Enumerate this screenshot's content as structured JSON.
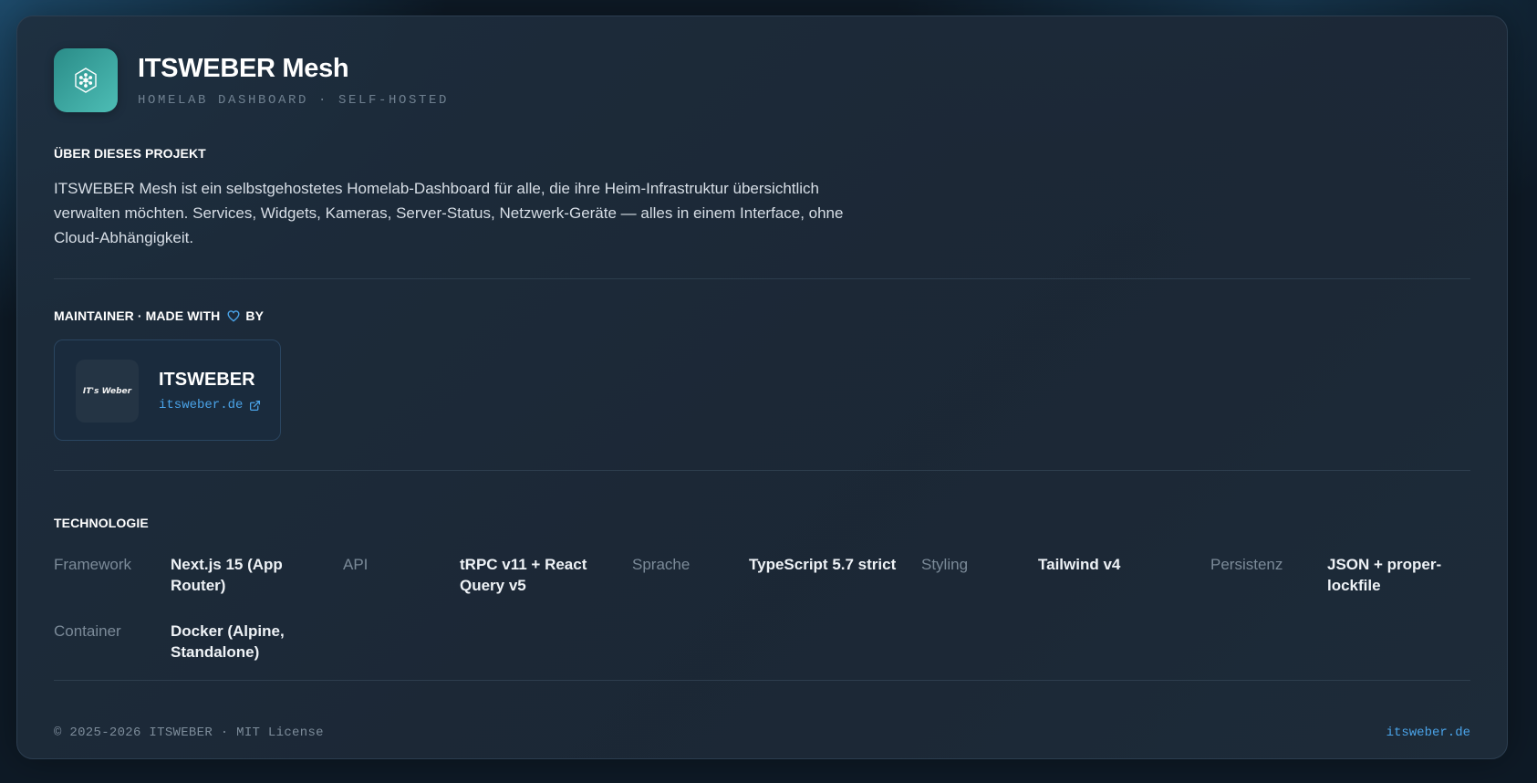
{
  "header": {
    "title": "ITSWEBER Mesh",
    "subtitle": "HOMELAB DASHBOARD · SELF-HOSTED",
    "logo_icon": "hexagon-network-icon"
  },
  "about": {
    "label": "ÜBER DIESES PROJEKT",
    "text": "ITSWEBER Mesh ist ein selbstgehostetes Homelab-Dashboard für alle, die ihre Heim-Infrastruktur übersichtlich verwalten möchten. Services, Widgets, Kameras, Server-Status, Netzwerk-Geräte — alles in einem Interface, ohne Cloud-Abhängigkeit."
  },
  "maintainer": {
    "label_prefix": "MAINTAINER · MADE WITH",
    "label_suffix": "BY",
    "heart_icon": "heart-icon",
    "name": "ITSWEBER",
    "logo_text": "IT's Weber",
    "link": "itsweber.de",
    "link_icon": "external-link-icon"
  },
  "technology": {
    "label": "TECHNOLOGIE",
    "rows": [
      [
        {
          "key": "Framework",
          "value": "Next.js 15 (App Router)"
        },
        {
          "key": "API",
          "value": "tRPC v11 + React Query v5"
        },
        {
          "key": "Sprache",
          "value": "TypeScript 5.7 strict"
        },
        {
          "key": "Styling",
          "value": "Tailwind v4"
        },
        {
          "key": "Persistenz",
          "value": "JSON + proper-lockfile"
        }
      ],
      [
        {
          "key": "Container",
          "value": "Docker (Alpine, Standalone)"
        }
      ]
    ]
  },
  "footer": {
    "copyright": "© 2025-2026 ITSWEBER · MIT License",
    "link": "itsweber.de"
  },
  "colors": {
    "accent": "#4aa3e8",
    "logo_teal": "#3aa6a0",
    "background": "#0e1a26"
  }
}
